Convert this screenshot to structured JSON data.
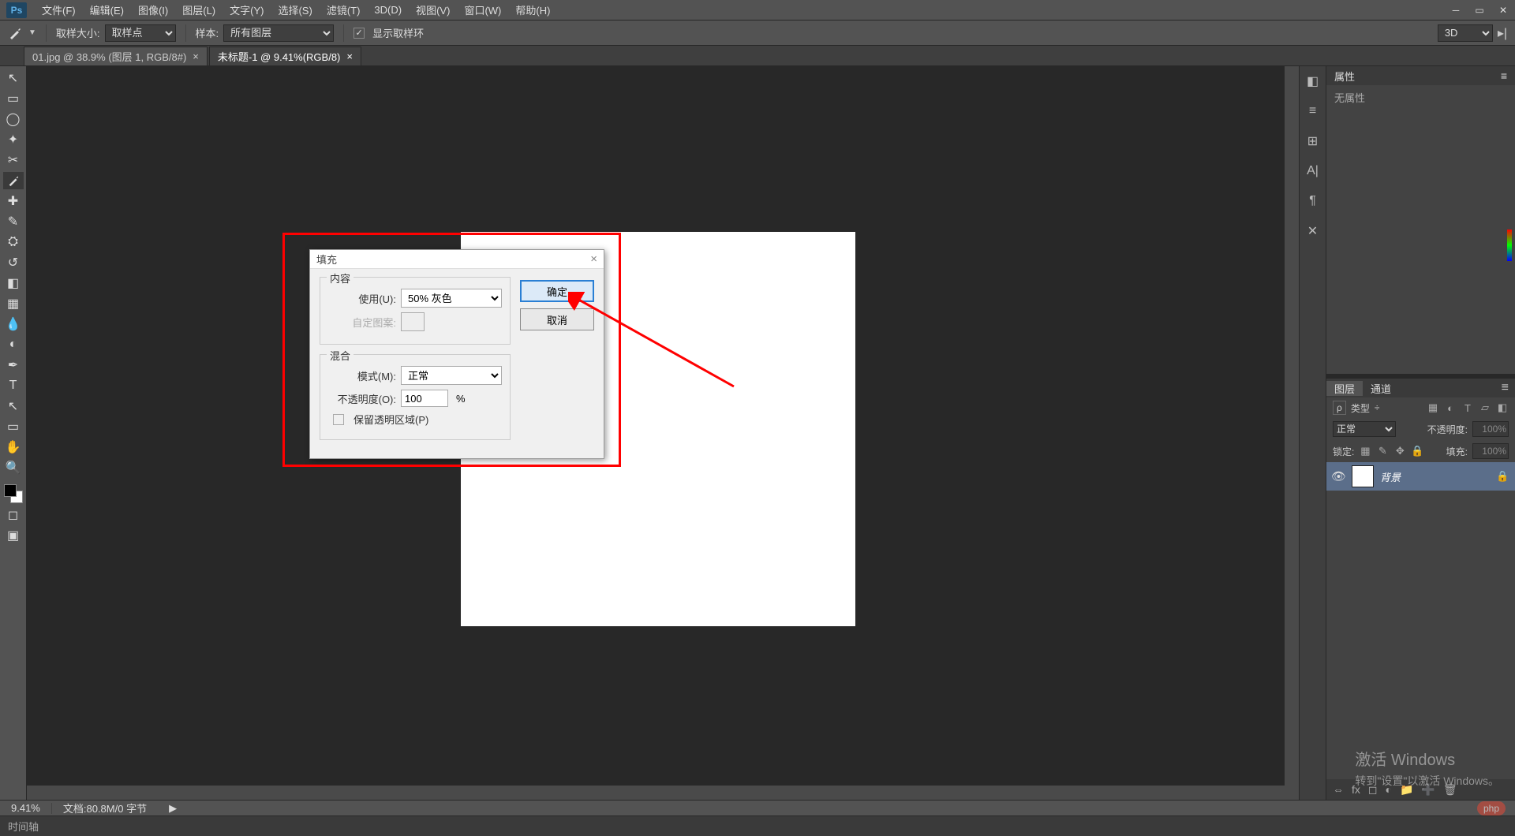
{
  "menubar": [
    "文件(F)",
    "编辑(E)",
    "图像(I)",
    "图层(L)",
    "文字(Y)",
    "选择(S)",
    "滤镜(T)",
    "3D(D)",
    "视图(V)",
    "窗口(W)",
    "帮助(H)"
  ],
  "optbar": {
    "sample_label": "取样大小:",
    "sample_value": "取样点",
    "range_label": "样本:",
    "range_value": "所有图层",
    "ring_label": "显示取样环",
    "mode_3d": "3D"
  },
  "tabs": [
    {
      "label": "01.jpg @ 38.9% (图层 1, RGB/8#)",
      "active": false
    },
    {
      "label": "未标题-1 @ 9.41%(RGB/8)",
      "active": true
    }
  ],
  "tools": [
    "↖",
    "▭",
    "⊙",
    "⬚",
    "✂",
    "⬚",
    "✎",
    "✎",
    "✎",
    "✎",
    "⟳",
    "✎",
    "●",
    "▲",
    "✒",
    "T",
    "↖",
    "✋",
    "🔍"
  ],
  "right_icons": [
    "◧",
    "≡",
    "⊞",
    "A|",
    "⬚",
    "✕"
  ],
  "panels": {
    "props_title": "属性",
    "props_empty": "无属性",
    "layers_tab": "图层",
    "channels_tab": "通道",
    "filter_label": "类型",
    "blend_label": "正常",
    "opacity_label": "不透明度:",
    "opacity_val": "100%",
    "lock_label": "锁定:",
    "fill_label": "填充:",
    "fill_val": "100%",
    "bg_layer": "背景"
  },
  "dialog": {
    "title": "填充",
    "ok": "确定",
    "cancel": "取消",
    "content_legend": "内容",
    "use_label": "使用(U):",
    "use_value": "50% 灰色",
    "pattern_label": "自定图案:",
    "blend_legend": "混合",
    "mode_label": "模式(M):",
    "mode_value": "正常",
    "op_label": "不透明度(O):",
    "op_value": "100",
    "pct": "%",
    "preserve": "保留透明区域(P)"
  },
  "status": {
    "zoom": "9.41%",
    "doc": "文档:80.8M/0 字节"
  },
  "timeline_label": "时间轴",
  "watermark": {
    "line1": "激活 Windows",
    "line2": "转到\"设置\"以激活 Windows。",
    "badge": "php"
  }
}
